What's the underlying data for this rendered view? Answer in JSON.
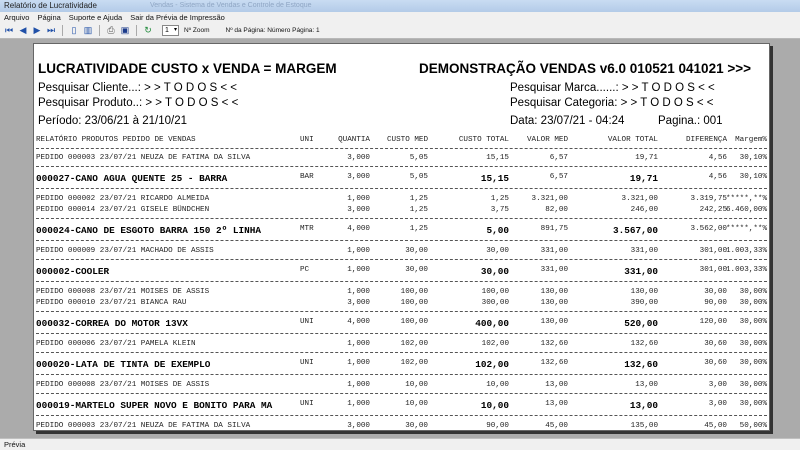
{
  "window": {
    "title": "Relatório de Lucratividade",
    "ghost_title": "Vendas - Sistema de Vendas e Controle de Estoque"
  },
  "menu": [
    "Arquivo",
    "Página",
    "Suporte e Ajuda",
    "Sair da Prévia de Impressão"
  ],
  "toolbar": {
    "zoom_value": "1",
    "zoom_label": "Nº Zoom",
    "page_label": "Nº da Página: Número Página: 1"
  },
  "report": {
    "title": "LUCRATIVIDADE CUSTO x VENDA = MARGEM",
    "subtitle": "DEMONSTRAÇÃO VENDAS v6.0 010521 041021 >>>",
    "filter_cliente": "Pesquisar Cliente...: > > T O D O S < <",
    "filter_produto": "Pesquisar Produto..: > > T O D O S < <",
    "filter_marca": "Pesquisar Marca......: > > T O D O S < <",
    "filter_categoria": "Pesquisar Categoria: > > T O D O S < <",
    "periodo": "Período: 23/06/21 à 21/10/21",
    "data": "Data: 23/07/21 - 04:24",
    "pagina": "Pagina.: 001",
    "columns": {
      "produto": "RELATÓRIO PRODUTOS PEDIDO DE VENDAS",
      "uni": "UNI",
      "quantia": "QUANTIA",
      "custo_med": "CUSTO MED",
      "custo_total": "CUSTO TOTAL",
      "valor_med": "VALOR MED",
      "valor_total": "VALOR TOTAL",
      "diferenca": "DIFERENÇA",
      "margem": "Margem%"
    },
    "rows": [
      {
        "kind": "detail",
        "desc": "PEDIDO 000003 23/07/21   NEUZA DE FATIMA DA SILVA",
        "uni": "",
        "qty": "3,000",
        "cmed": "5,05",
        "ctot": "15,15",
        "vmed": "6,57",
        "vtot": "19,71",
        "dif": "4,56",
        "marg": "30,10%"
      },
      {
        "kind": "sep"
      },
      {
        "kind": "total",
        "desc": "000027-CANO AGUA QUENTE 25 - BARRA",
        "uni": "BAR",
        "qty": "3,000",
        "cmed": "5,05",
        "ctot": "15,15",
        "vmed": "6,57",
        "vtot": "19,71",
        "dif": "4,56",
        "marg": "30,10%"
      },
      {
        "kind": "sep"
      },
      {
        "kind": "detail",
        "desc": "PEDIDO 000002 23/07/21   RICARDO ALMEIDA",
        "uni": "",
        "qty": "1,000",
        "cmed": "1,25",
        "ctot": "1,25",
        "vmed": "3.321,00",
        "vtot": "3.321,00",
        "dif": "3.319,75",
        "marg": "*****,**%"
      },
      {
        "kind": "detail",
        "desc": "PEDIDO 000014 23/07/21   GISELE BÜNDCHEN",
        "uni": "",
        "qty": "3,000",
        "cmed": "1,25",
        "ctot": "3,75",
        "vmed": "82,00",
        "vtot": "246,00",
        "dif": "242,25",
        "marg": "6.460,00%"
      },
      {
        "kind": "sep"
      },
      {
        "kind": "total",
        "desc": "000024-CANO DE ESGOTO BARRA 150 2º LINHA",
        "uni": "MTR",
        "qty": "4,000",
        "cmed": "1,25",
        "ctot": "5,00",
        "vmed": "891,75",
        "vtot": "3.567,00",
        "dif": "3.562,00",
        "marg": "*****,**%"
      },
      {
        "kind": "sep"
      },
      {
        "kind": "detail",
        "desc": "PEDIDO 000009 23/07/21   MACHADO DE ASSIS",
        "uni": "",
        "qty": "1,000",
        "cmed": "30,00",
        "ctot": "30,00",
        "vmed": "331,00",
        "vtot": "331,00",
        "dif": "301,00",
        "marg": "1.003,33%"
      },
      {
        "kind": "sep"
      },
      {
        "kind": "total",
        "desc": "000002-COOLER",
        "uni": "PC",
        "qty": "1,000",
        "cmed": "30,00",
        "ctot": "30,00",
        "vmed": "331,00",
        "vtot": "331,00",
        "dif": "301,00",
        "marg": "1.003,33%"
      },
      {
        "kind": "sep"
      },
      {
        "kind": "detail",
        "desc": "PEDIDO 000008 23/07/21   MOISES DE ASSIS",
        "uni": "",
        "qty": "1,000",
        "cmed": "100,00",
        "ctot": "100,00",
        "vmed": "130,00",
        "vtot": "130,00",
        "dif": "30,00",
        "marg": "30,00%"
      },
      {
        "kind": "detail",
        "desc": "PEDIDO 000010 23/07/21   BIANCA RAU",
        "uni": "",
        "qty": "3,000",
        "cmed": "100,00",
        "ctot": "300,00",
        "vmed": "130,00",
        "vtot": "390,00",
        "dif": "90,00",
        "marg": "30,00%"
      },
      {
        "kind": "sep"
      },
      {
        "kind": "total",
        "desc": "000032-CORREA DO MOTOR 13VX",
        "uni": "UNI",
        "qty": "4,000",
        "cmed": "100,00",
        "ctot": "400,00",
        "vmed": "130,00",
        "vtot": "520,00",
        "dif": "120,00",
        "marg": "30,00%"
      },
      {
        "kind": "sep"
      },
      {
        "kind": "detail",
        "desc": "PEDIDO 000006 23/07/21   PAMELA KLEIN",
        "uni": "",
        "qty": "1,000",
        "cmed": "102,00",
        "ctot": "102,00",
        "vmed": "132,60",
        "vtot": "132,60",
        "dif": "30,60",
        "marg": "30,00%"
      },
      {
        "kind": "sep"
      },
      {
        "kind": "total",
        "desc": "000020-LATA DE TINTA DE EXEMPLO",
        "uni": "UNI",
        "qty": "1,000",
        "cmed": "102,00",
        "ctot": "102,00",
        "vmed": "132,60",
        "vtot": "132,60",
        "dif": "30,60",
        "marg": "30,00%"
      },
      {
        "kind": "sep"
      },
      {
        "kind": "detail",
        "desc": "PEDIDO 000008 23/07/21   MOISES DE ASSIS",
        "uni": "",
        "qty": "1,000",
        "cmed": "10,00",
        "ctot": "10,00",
        "vmed": "13,00",
        "vtot": "13,00",
        "dif": "3,00",
        "marg": "30,00%"
      },
      {
        "kind": "sep"
      },
      {
        "kind": "total",
        "desc": "000019-MARTELO SUPER NOVO E BONITO PARA MA",
        "uni": "UNI",
        "qty": "1,000",
        "cmed": "10,00",
        "ctot": "10,00",
        "vmed": "13,00",
        "vtot": "13,00",
        "dif": "3,00",
        "marg": "30,00%"
      },
      {
        "kind": "sep"
      },
      {
        "kind": "detail",
        "desc": "PEDIDO 000003 23/07/21   NEUZA DE FATIMA DA SILVA",
        "uni": "",
        "qty": "3,000",
        "cmed": "30,00",
        "ctot": "90,00",
        "vmed": "45,00",
        "vtot": "135,00",
        "dif": "45,00",
        "marg": "50,00%"
      }
    ]
  },
  "status": {
    "text": "Prévia"
  }
}
